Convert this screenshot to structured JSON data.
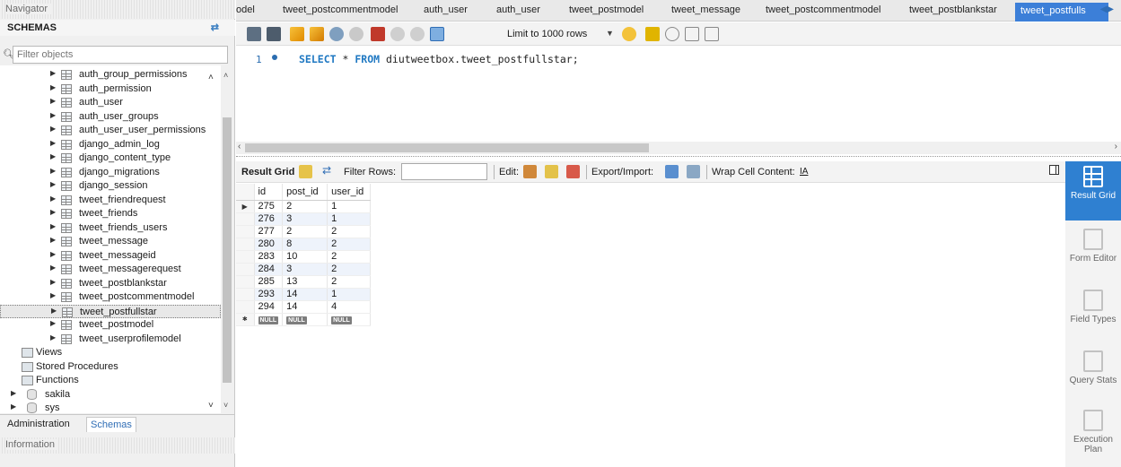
{
  "navigator": {
    "title": "Navigator",
    "schemas_label": "SCHEMAS",
    "filter_placeholder": "Filter objects",
    "tables": [
      "auth_group_permissions",
      "auth_permission",
      "auth_user",
      "auth_user_groups",
      "auth_user_user_permissions",
      "django_admin_log",
      "django_content_type",
      "django_migrations",
      "django_session",
      "tweet_friendrequest",
      "tweet_friends",
      "tweet_friends_users",
      "tweet_message",
      "tweet_messageid",
      "tweet_messagerequest",
      "tweet_postblankstar",
      "tweet_postcommentmodel",
      "tweet_postfullstar",
      "tweet_postmodel",
      "tweet_userprofilemodel"
    ],
    "selected_table": "tweet_postfullstar",
    "folders": [
      "Views",
      "Stored Procedures",
      "Functions"
    ],
    "schemas": [
      "sakila",
      "sys"
    ],
    "bottom_tabs": {
      "administration": "Administration",
      "schemas": "Schemas"
    },
    "information_title": "Information"
  },
  "tabs": [
    "odel",
    "tweet_postcommentmodel",
    "auth_user",
    "auth_user",
    "tweet_postmodel",
    "tweet_message",
    "tweet_postcommentmodel",
    "tweet_postblankstar",
    "tweet_postfulls"
  ],
  "toolbar": {
    "limit_label": "Limit to 1000 rows"
  },
  "editor": {
    "line_number": "1",
    "keyword_select": "SELECT",
    "star": "*",
    "keyword_from": "FROM",
    "target": "diutweetbox.tweet_postfullstar;"
  },
  "result_toolbar": {
    "result_grid": "Result Grid",
    "filter_rows": "Filter Rows:",
    "edit": "Edit:",
    "export_import": "Export/Import:",
    "wrap": "Wrap Cell Content:",
    "wrap_icon_glyph": "IA"
  },
  "grid": {
    "columns": [
      "id",
      "post_id",
      "user_id"
    ],
    "rows": [
      [
        "275",
        "2",
        "1"
      ],
      [
        "276",
        "3",
        "1"
      ],
      [
        "277",
        "2",
        "2"
      ],
      [
        "280",
        "8",
        "2"
      ],
      [
        "283",
        "10",
        "2"
      ],
      [
        "284",
        "3",
        "2"
      ],
      [
        "285",
        "13",
        "2"
      ],
      [
        "293",
        "14",
        "1"
      ],
      [
        "294",
        "14",
        "4"
      ]
    ],
    "null_label": "NULL"
  },
  "side_panel": {
    "items": [
      "Result Grid",
      "Form Editor",
      "Field Types",
      "Query Stats",
      "Execution Plan"
    ]
  }
}
